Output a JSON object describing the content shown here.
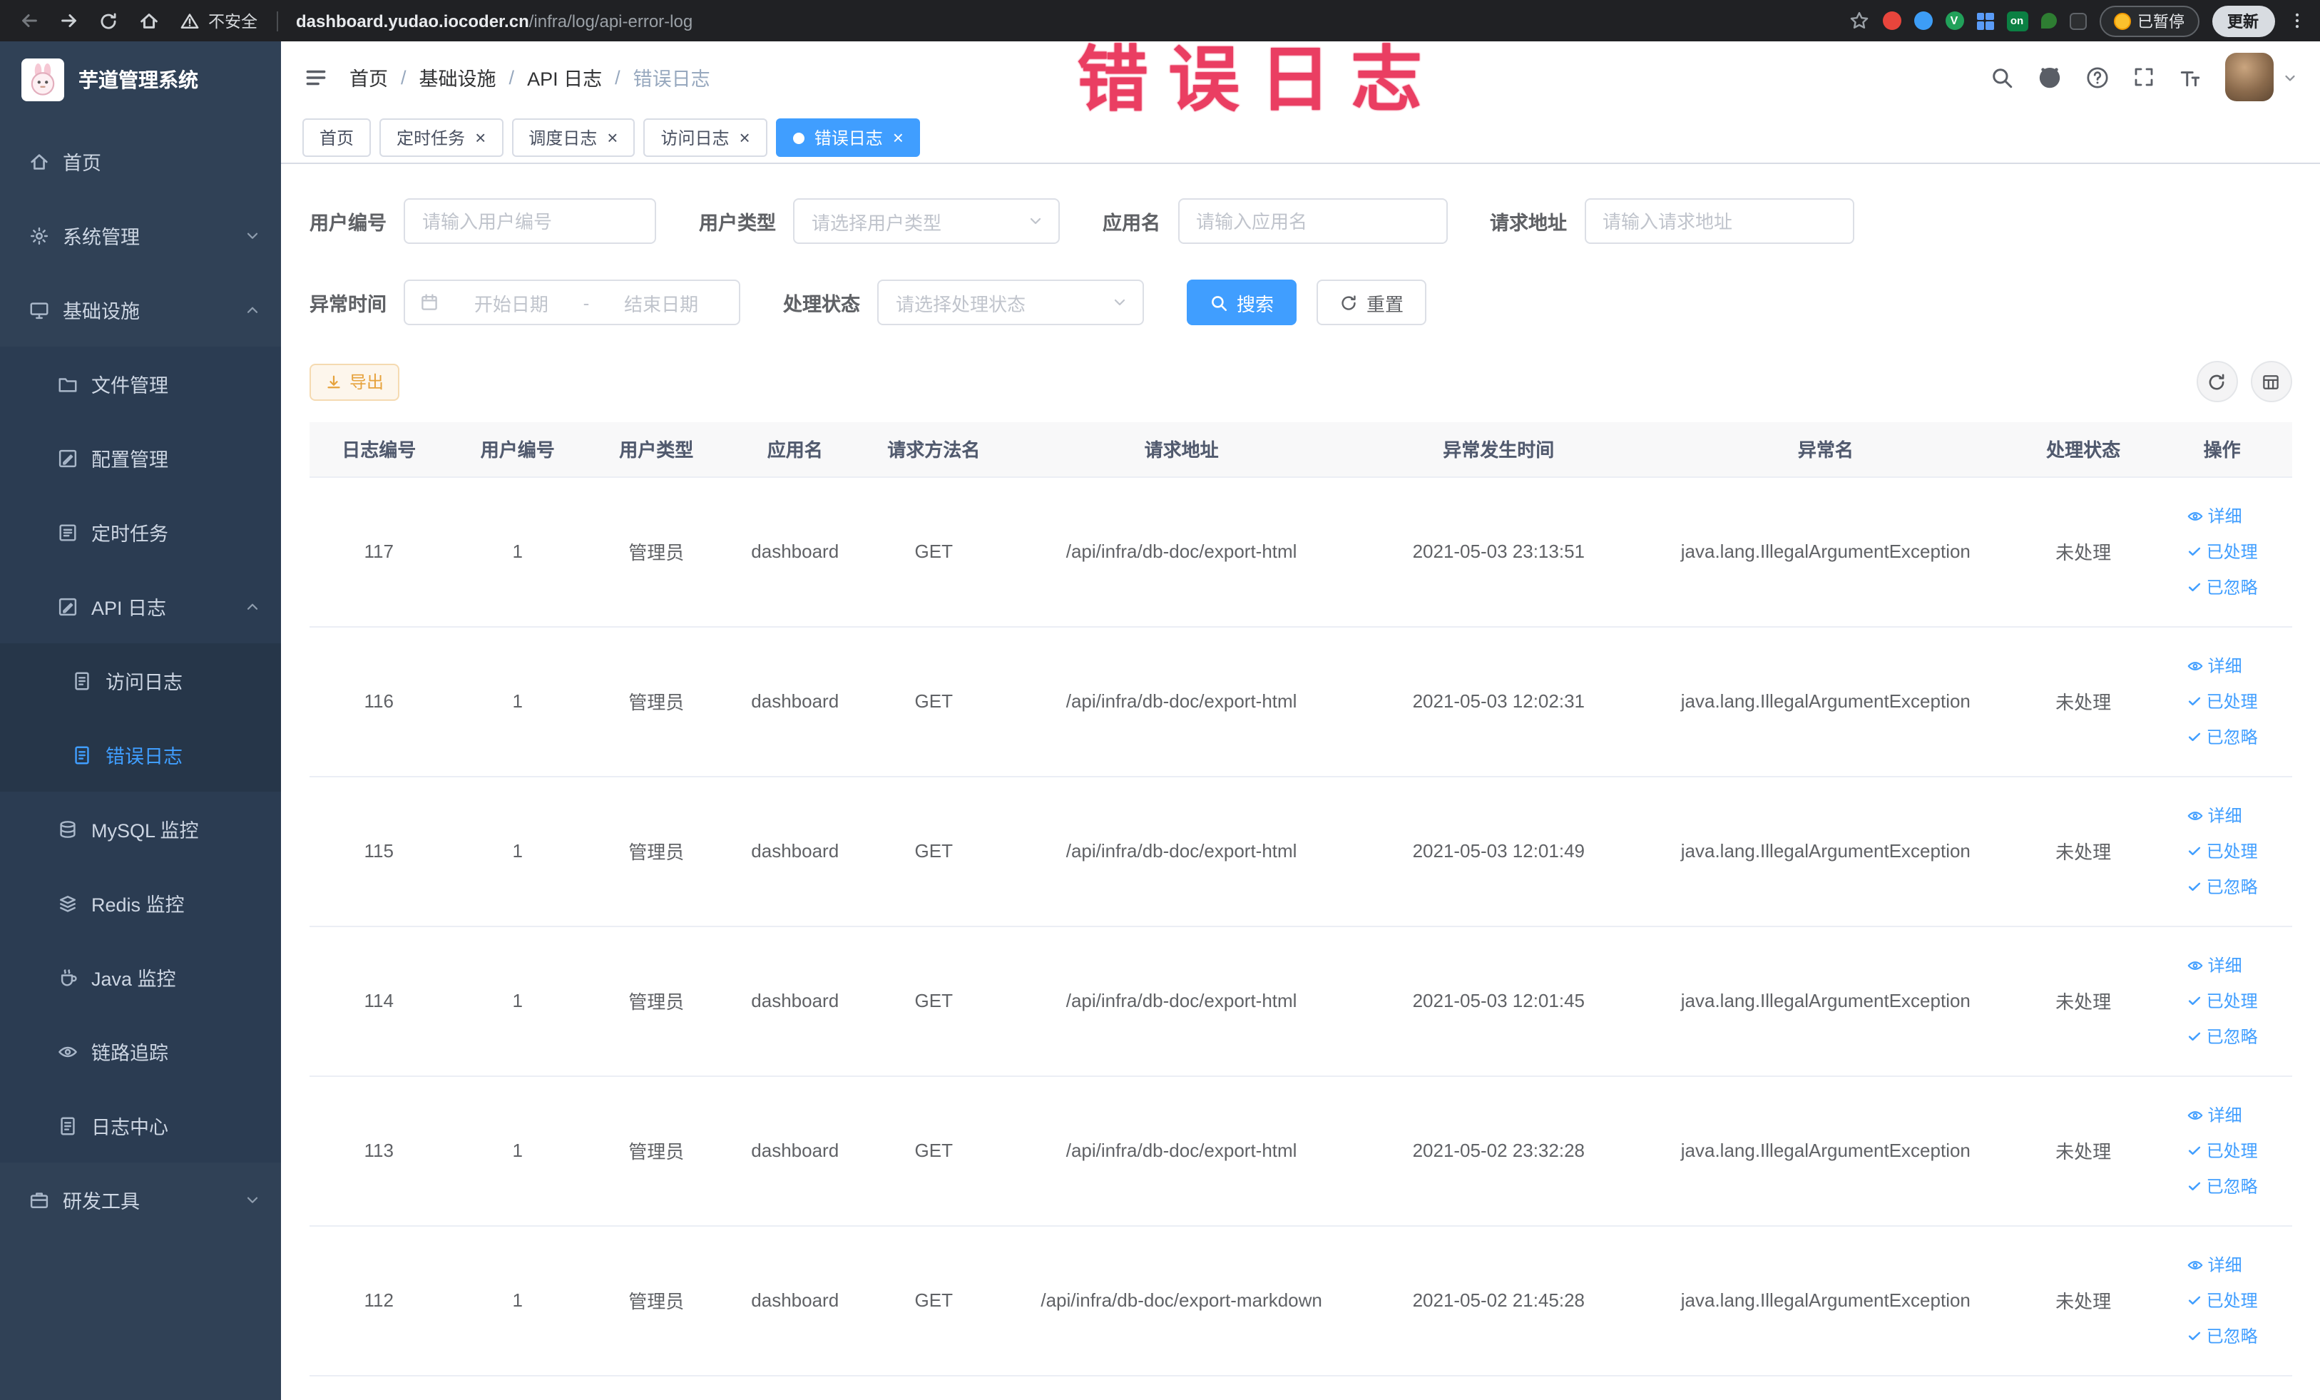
{
  "colors": {
    "accent": "#409eff",
    "sidebar_bg": "#304156",
    "warning": "#e6a23c",
    "annotation": "#ea3e62"
  },
  "annotation": {
    "text": "错误日志"
  },
  "browser": {
    "security_label": "不安全",
    "url_host": "dashboard.yudao.iocoder.cn",
    "url_path": "/infra/log/api-error-log",
    "ext_v_badge": "V",
    "ext_on_badge": "on",
    "paused_label": "已暂停",
    "update_label": "更新"
  },
  "sidebar": {
    "logo_title": "芋道管理系统",
    "items": [
      {
        "label": "首页"
      },
      {
        "label": "系统管理"
      },
      {
        "label": "基础设施"
      },
      {
        "label": "文件管理"
      },
      {
        "label": "配置管理"
      },
      {
        "label": "定时任务"
      },
      {
        "label": "API 日志"
      },
      {
        "label": "访问日志"
      },
      {
        "label": "错误日志"
      },
      {
        "label": "MySQL 监控"
      },
      {
        "label": "Redis 监控"
      },
      {
        "label": "Java 监控"
      },
      {
        "label": "链路追踪"
      },
      {
        "label": "日志中心"
      },
      {
        "label": "研发工具"
      }
    ]
  },
  "header": {
    "breadcrumb": [
      "首页",
      "基础设施",
      "API 日志",
      "错误日志"
    ],
    "breadcrumb_separator": "/"
  },
  "tabs": [
    {
      "label": "首页"
    },
    {
      "label": "定时任务"
    },
    {
      "label": "调度日志"
    },
    {
      "label": "访问日志"
    },
    {
      "label": "错误日志"
    }
  ],
  "filters": {
    "user_id_label": "用户编号",
    "user_id_placeholder": "请输入用户编号",
    "user_type_label": "用户类型",
    "user_type_placeholder": "请选择用户类型",
    "app_name_label": "应用名",
    "app_name_placeholder": "请输入应用名",
    "request_url_label": "请求地址",
    "request_url_placeholder": "请输入请求地址",
    "exception_time_label": "异常时间",
    "date_start_placeholder": "开始日期",
    "date_end_placeholder": "结束日期",
    "range_separator": "-",
    "status_label": "处理状态",
    "status_placeholder": "请选择处理状态",
    "search_label": "搜索",
    "reset_label": "重置"
  },
  "toolbar": {
    "export_label": "导出"
  },
  "table": {
    "columns": [
      "日志编号",
      "用户编号",
      "用户类型",
      "应用名",
      "请求方法名",
      "请求地址",
      "异常发生时间",
      "异常名",
      "处理状态",
      "操作"
    ],
    "actions": [
      "详细",
      "已处理",
      "已忽略"
    ],
    "rows": [
      {
        "id": "117",
        "user_id": "1",
        "user_type": "管理员",
        "app": "dashboard",
        "method": "GET",
        "url": "/api/infra/db-doc/export-html",
        "time": "2021-05-03 23:13:51",
        "exception": "java.lang.IllegalArgumentException",
        "status": "未处理"
      },
      {
        "id": "116",
        "user_id": "1",
        "user_type": "管理员",
        "app": "dashboard",
        "method": "GET",
        "url": "/api/infra/db-doc/export-html",
        "time": "2021-05-03 12:02:31",
        "exception": "java.lang.IllegalArgumentException",
        "status": "未处理"
      },
      {
        "id": "115",
        "user_id": "1",
        "user_type": "管理员",
        "app": "dashboard",
        "method": "GET",
        "url": "/api/infra/db-doc/export-html",
        "time": "2021-05-03 12:01:49",
        "exception": "java.lang.IllegalArgumentException",
        "status": "未处理"
      },
      {
        "id": "114",
        "user_id": "1",
        "user_type": "管理员",
        "app": "dashboard",
        "method": "GET",
        "url": "/api/infra/db-doc/export-html",
        "time": "2021-05-03 12:01:45",
        "exception": "java.lang.IllegalArgumentException",
        "status": "未处理"
      },
      {
        "id": "113",
        "user_id": "1",
        "user_type": "管理员",
        "app": "dashboard",
        "method": "GET",
        "url": "/api/infra/db-doc/export-html",
        "time": "2021-05-02 23:32:28",
        "exception": "java.lang.IllegalArgumentException",
        "status": "未处理"
      },
      {
        "id": "112",
        "user_id": "1",
        "user_type": "管理员",
        "app": "dashboard",
        "method": "GET",
        "url": "/api/infra/db-doc/export-markdown",
        "time": "2021-05-02 21:45:28",
        "exception": "java.lang.IllegalArgumentException",
        "status": "未处理"
      }
    ]
  }
}
